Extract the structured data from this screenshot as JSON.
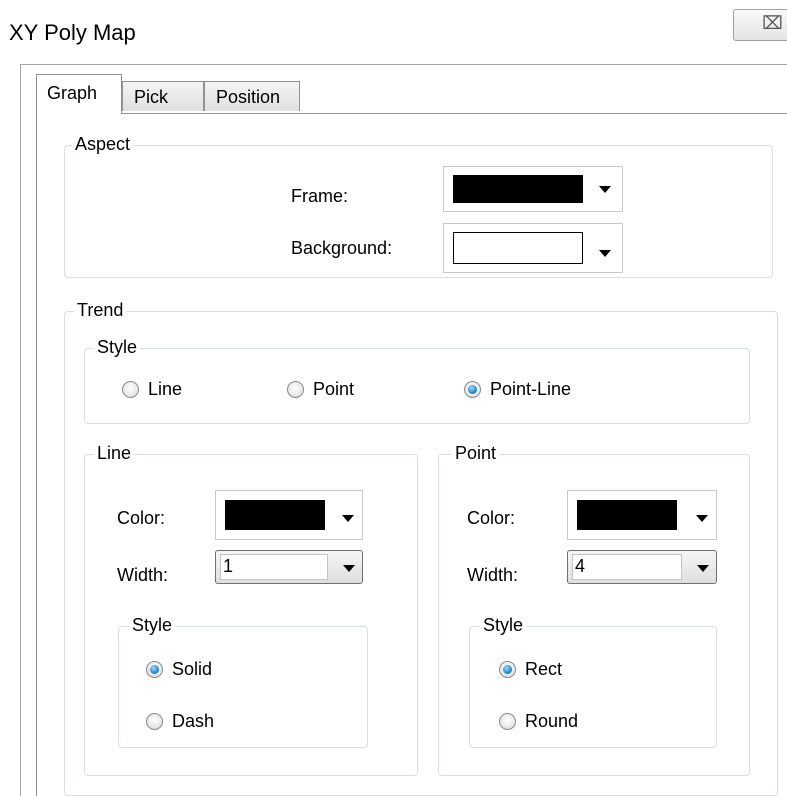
{
  "window": {
    "title": "XY Poly Map",
    "close_glyph": "⌧"
  },
  "tabs": [
    {
      "label": "Graph",
      "active": true
    },
    {
      "label": "Pick",
      "active": false
    },
    {
      "label": "Position",
      "active": false
    }
  ],
  "aspect": {
    "group_label": "Aspect",
    "frame_label": "Frame:",
    "frame_color": "#000000",
    "background_label": "Background:",
    "background_color": "#ffffff"
  },
  "trend": {
    "group_label": "Trend",
    "style": {
      "group_label": "Style",
      "options": [
        {
          "label": "Line",
          "checked": false
        },
        {
          "label": "Point",
          "checked": false
        },
        {
          "label": "Point-Line",
          "checked": true
        }
      ]
    },
    "line": {
      "group_label": "Line",
      "color_label": "Color:",
      "color": "#000000",
      "width_label": "Width:",
      "width_value": "1",
      "style": {
        "group_label": "Style",
        "options": [
          {
            "label": "Solid",
            "checked": true
          },
          {
            "label": "Dash",
            "checked": false
          }
        ]
      }
    },
    "point": {
      "group_label": "Point",
      "color_label": "Color:",
      "color": "#000000",
      "width_label": "Width:",
      "width_value": "4",
      "style": {
        "group_label": "Style",
        "options": [
          {
            "label": "Rect",
            "checked": true
          },
          {
            "label": "Round",
            "checked": false
          }
        ]
      }
    }
  }
}
